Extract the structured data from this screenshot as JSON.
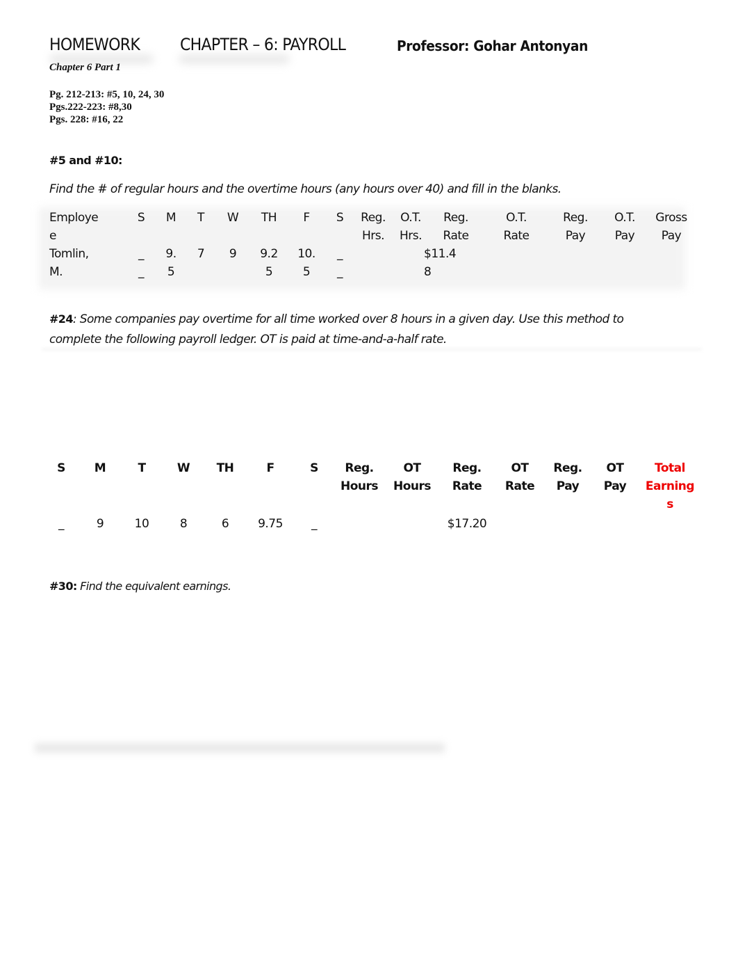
{
  "header": {
    "homework": "HOMEWORK",
    "chapter": "CHAPTER – 6: PAYROLL",
    "professor": "Professor: Gohar Antonyan",
    "subtitle": "Chapter 6 Part 1"
  },
  "assignments": [
    "Pg. 212-213:  #5, 10, 24, 30",
    "Pgs.222-223:  #8,30",
    "Pgs. 228:  #16, 22"
  ],
  "q5_10": {
    "heading": "#5 and #10:",
    "instruction": "Find the # of regular hours and the overtime hours (any hours over 40) and fill in the blanks.",
    "columns": [
      "Employe\ne",
      "S",
      "M",
      "T",
      "W",
      "TH",
      "F",
      "S",
      "Reg.\nHrs.",
      "O.T.\nHrs.",
      "Reg.\nRate",
      "O.T.\nRate",
      "Reg.\nPay",
      "O.T.\nPay",
      "Gross\nPay"
    ],
    "row": [
      "Tomlin,\nM.",
      "_\n_",
      "9.\n5",
      "7",
      "9",
      "9.2\n5",
      "10.\n5",
      "_\n_",
      "",
      "",
      "$11.4\n8",
      "",
      "",
      "",
      ""
    ]
  },
  "q24": {
    "label": "#24",
    "instruction": ": Some companies pay overtime for all time worked over 8 hours in a given day. Use this method to complete the following payroll ledger. OT is paid at time-and-a-half rate.",
    "columns": [
      "S",
      "M",
      "T",
      "W",
      "TH",
      "F",
      "S",
      "Reg.\nHours",
      "OT\nHours",
      "Reg.\nRate",
      "OT\nRate",
      "Reg.\nPay",
      "OT\nPay",
      "Total\nEarning\ns"
    ],
    "row": [
      "_",
      "9",
      "10",
      "8",
      "6",
      "9.75",
      "_",
      "",
      "",
      "$17.20",
      "",
      "",
      "",
      ""
    ],
    "highlight_color": "#ee0000"
  },
  "q30": {
    "label": "#30:",
    "instruction": " Find the equivalent earnings."
  }
}
